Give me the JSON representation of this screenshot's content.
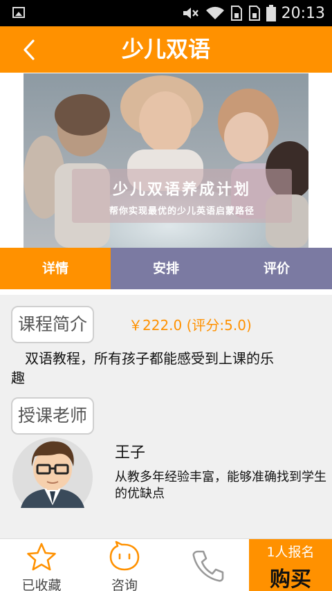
{
  "status_bar": {
    "time": "20:13",
    "icons": [
      "image-icon",
      "mute-icon",
      "wifi-icon",
      "sim1-icon",
      "sim2-icon",
      "battery-icon"
    ]
  },
  "header": {
    "title": "少儿双语",
    "back_icon": "chevron-left-icon"
  },
  "banner": {
    "title": "少儿双语养成计划",
    "subtitle": "帮你实现最优的少儿英语启蒙路径"
  },
  "tabs": [
    {
      "label": "详情",
      "active": true
    },
    {
      "label": "安排",
      "active": false
    },
    {
      "label": "评价",
      "active": false
    }
  ],
  "course": {
    "section_label": "课程简介",
    "price": "￥222.0",
    "rating": "(评分:5.0)",
    "description": "　双语教程，所有孩子都能感受到上课的乐趣"
  },
  "teacher": {
    "section_label": "授课老师",
    "name": "王子",
    "description": "从教多年经验丰富，能够准确找到学生的优缺点"
  },
  "bottom_bar": {
    "favorite_label": "已收藏",
    "consult_label": "咨询",
    "enroll_count": "1人报名",
    "buy_label": "购买"
  },
  "colors": {
    "accent": "#ff9100",
    "tab_inactive": "#7b7aa2"
  }
}
